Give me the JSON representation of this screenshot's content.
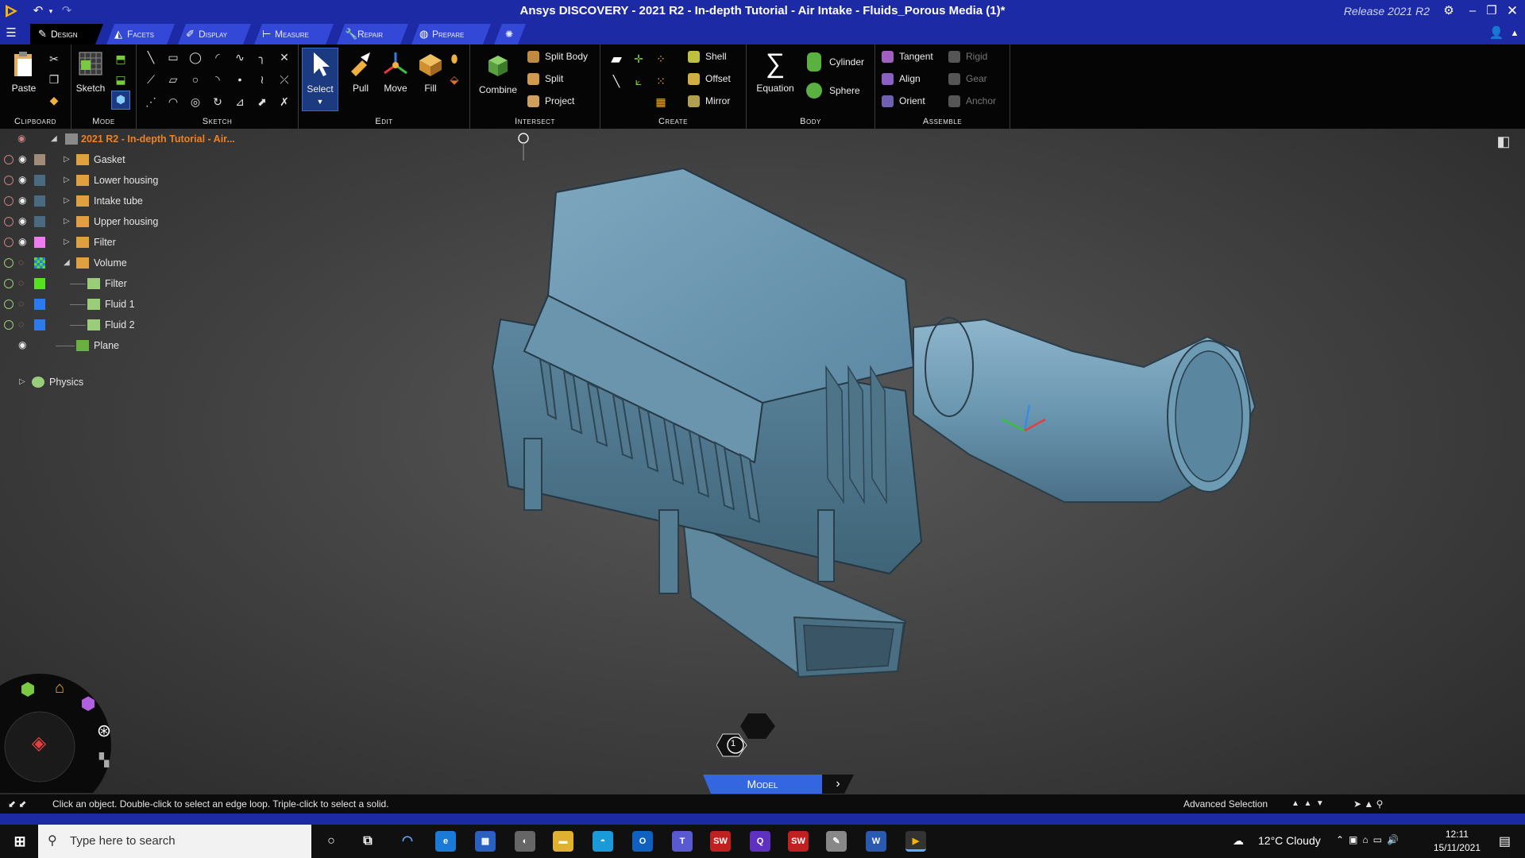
{
  "window": {
    "title": "Ansys DISCOVERY - 2021 R2 - In-depth Tutorial - Air Intake - Fluids_Porous Media (1)*",
    "release": "Release 2021 R2"
  },
  "tabs": [
    {
      "label": "Design",
      "icon": "pencil-icon",
      "active": true
    },
    {
      "label": "Facets",
      "icon": "facets-icon"
    },
    {
      "label": "Display",
      "icon": "display-icon"
    },
    {
      "label": "Measure",
      "icon": "ruler-icon"
    },
    {
      "label": "Repair",
      "icon": "wrench-icon"
    },
    {
      "label": "Prepare",
      "icon": "prepare-icon"
    }
  ],
  "ribbon": {
    "clipboard": {
      "label": "Clipboard",
      "paste": "Paste"
    },
    "mode": {
      "label": "Mode",
      "sketch": "Sketch"
    },
    "sketch": {
      "label": "Sketch"
    },
    "edit": {
      "label": "Edit",
      "select": "Select",
      "pull": "Pull",
      "move": "Move",
      "fill": "Fill"
    },
    "intersect": {
      "label": "Intersect",
      "combine": "Combine",
      "split_body": "Split Body",
      "split": "Split",
      "project": "Project"
    },
    "create": {
      "label": "Create",
      "shell": "Shell",
      "offset": "Offset",
      "mirror": "Mirror"
    },
    "body": {
      "label": "Body",
      "equation": "Equation",
      "cylinder": "Cylinder",
      "sphere": "Sphere"
    },
    "assemble": {
      "label": "Assemble",
      "tangent": "Tangent",
      "align": "Align",
      "orient": "Orient",
      "rigid": "Rigid",
      "gear": "Gear",
      "anchor": "Anchor"
    }
  },
  "tree": {
    "root": "2021 R2 - In-depth Tutorial - Air...",
    "items": [
      {
        "label": "Gasket",
        "color": "#a08a78"
      },
      {
        "label": "Lower housing",
        "color": "#4a6a80"
      },
      {
        "label": "Intake tube",
        "color": "#4a6a80"
      },
      {
        "label": "Upper housing",
        "color": "#4a6a80"
      },
      {
        "label": "Filter",
        "color": "#f07af0"
      },
      {
        "label": "Volume",
        "color": "#888888"
      },
      {
        "label": "Filter",
        "color": "#55e020"
      },
      {
        "label": "Fluid 1",
        "color": "#2a7af0"
      },
      {
        "label": "Fluid 2",
        "color": "#2a7af0"
      },
      {
        "label": "Plane",
        "color": ""
      }
    ],
    "physics": "Physics"
  },
  "viewport": {
    "model_tab": "Model",
    "hex_label": "1"
  },
  "status": {
    "hint": "Click an object. Double-click to select an edge loop. Triple-click to select a solid.",
    "mode": "Advanced Selection"
  },
  "taskbar": {
    "search_placeholder": "Type here to search",
    "weather": "12°C  Cloudy",
    "time": "12:11",
    "date": "15/11/2021"
  }
}
